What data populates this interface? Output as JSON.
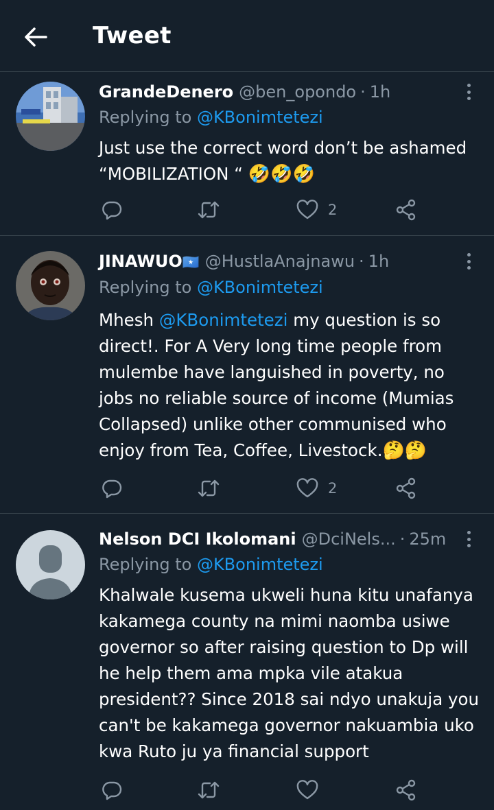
{
  "header": {
    "title": "Tweet",
    "back_icon": "arrow-left-icon"
  },
  "tweets": [
    {
      "name": "GrandeDenero",
      "handle": "@ben_opondo",
      "separator": "·",
      "time": "1h",
      "replying_prefix": "Replying to ",
      "replying_to": "@KBonimtetezi",
      "text_line1": "Just use the correct word don’t be ashamed",
      "text_line2": "“MOBILIZATION “ ",
      "emoji": "🤣🤣🤣",
      "reply_count": "",
      "retweet_count": "",
      "like_count": "2"
    },
    {
      "name": "JINAWUO",
      "name_flag": "🇸🇴",
      "handle": "@HustlaAnajnawu",
      "separator": "·",
      "time": "1h",
      "replying_prefix": "Replying to ",
      "replying_to": "@KBonimtetezi",
      "text_pre": "Mhesh ",
      "text_mention": "@KBonimtetezi",
      "text_post": " my question is so direct!. For A Very long time people from mulembe have languished in poverty, no jobs no reliable source of income (Mumias Collapsed) unlike other communised who enjoy from Tea, Coffee, Livestock.",
      "emoji": "🤔🤔",
      "reply_count": "",
      "retweet_count": "",
      "like_count": "2"
    },
    {
      "name": "Nelson DCI Ikolomani",
      "handle": "@DciNels...",
      "separator": "·",
      "time": "25m",
      "replying_prefix": "Replying to ",
      "replying_to": "@KBonimtetezi",
      "text": "Khalwale kusema ukweli huna kitu unafanya kakamega county na mimi naomba usiwe governor so after raising question to Dp will he help them ama mpka vile atakua president?? Since 2018 sai ndyo unakuja you can't be kakamega governor nakuambia uko kwa Ruto ju ya financial support",
      "reply_count": "",
      "retweet_count": "",
      "like_count": ""
    }
  ],
  "colors": {
    "background": "#15202b",
    "divider": "#38444d",
    "secondary_text": "#8b98a5",
    "accent": "#1d9bf0"
  },
  "icons": [
    "reply-icon",
    "retweet-icon",
    "like-icon",
    "share-icon",
    "more-icon"
  ]
}
